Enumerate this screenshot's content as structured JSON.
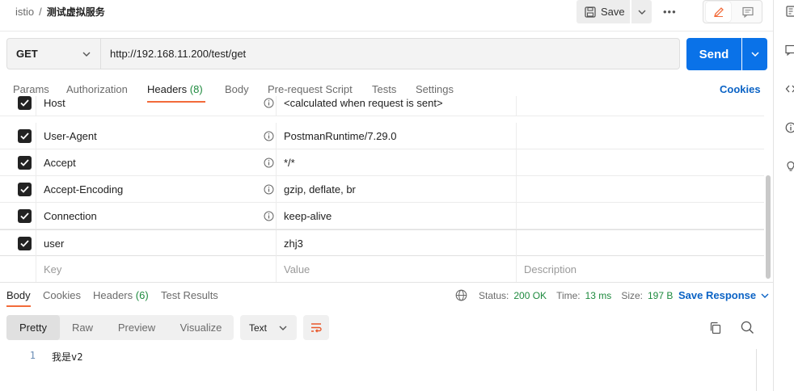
{
  "breadcrumb": {
    "parent": "istio",
    "separator": "/",
    "current": "测试虚拟服务"
  },
  "toolbar": {
    "save_label": "Save",
    "more_label": "•••"
  },
  "request": {
    "method": "GET",
    "url": "http://192.168.11.200/test/get",
    "send_label": "Send"
  },
  "request_tabs": [
    {
      "label": "Params"
    },
    {
      "label": "Authorization"
    },
    {
      "label": "Headers",
      "count": "(8)"
    },
    {
      "label": "Body"
    },
    {
      "label": "Pre-request Script"
    },
    {
      "label": "Tests"
    },
    {
      "label": "Settings"
    }
  ],
  "cookies_label": "Cookies",
  "headers": [
    {
      "key": "Host",
      "value": "<calculated when request is sent>",
      "checked": true,
      "auto": true
    },
    {
      "key": "User-Agent",
      "value": "PostmanRuntime/7.29.0",
      "checked": true,
      "auto": true
    },
    {
      "key": "Accept",
      "value": "*/*",
      "checked": true,
      "auto": true
    },
    {
      "key": "Accept-Encoding",
      "value": "gzip, deflate, br",
      "checked": true,
      "auto": true
    },
    {
      "key": "Connection",
      "value": "keep-alive",
      "checked": true,
      "auto": true
    },
    {
      "key": "user",
      "value": "zhj3",
      "checked": true,
      "auto": false
    }
  ],
  "new_row": {
    "key_placeholder": "Key",
    "value_placeholder": "Value",
    "description_placeholder": "Description"
  },
  "response_tabs": [
    {
      "label": "Body"
    },
    {
      "label": "Cookies"
    },
    {
      "label": "Headers",
      "count": "(6)"
    },
    {
      "label": "Test Results"
    }
  ],
  "response_status": {
    "status_label": "Status:",
    "status_value": "200 OK",
    "time_label": "Time:",
    "time_value": "13 ms",
    "size_label": "Size:",
    "size_value": "197 B"
  },
  "save_response_label": "Save Response",
  "body_views": [
    {
      "label": "Pretty"
    },
    {
      "label": "Raw"
    },
    {
      "label": "Preview"
    },
    {
      "label": "Visualize"
    }
  ],
  "format_label": "Text",
  "response_body": [
    {
      "line": "1",
      "text": "我是v2"
    }
  ],
  "colors": {
    "accent": "#0a72e8",
    "active_tab": "#f26b3a",
    "status_ok": "#1e8a3e",
    "link": "#0b63c5"
  }
}
